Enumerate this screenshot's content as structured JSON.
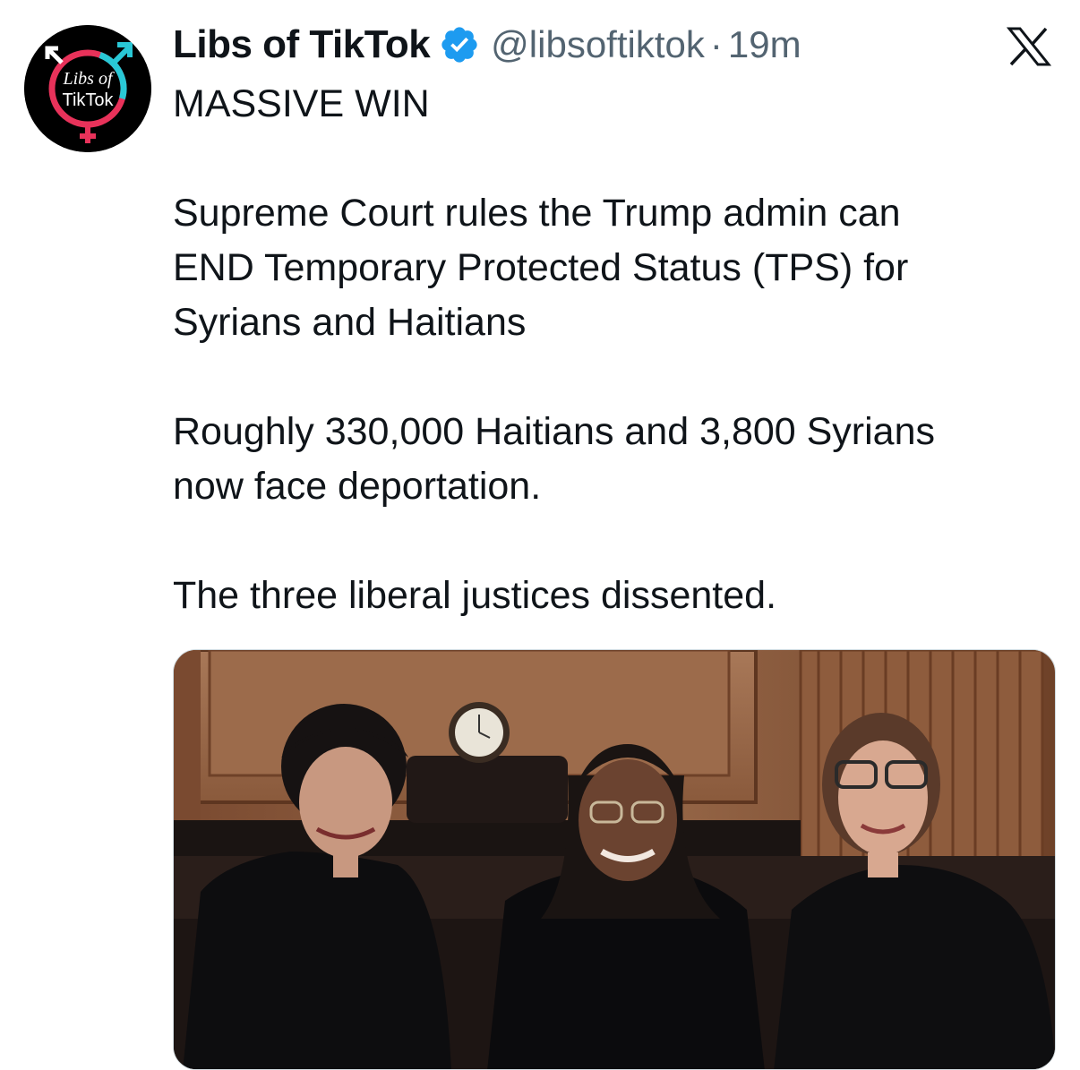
{
  "author": {
    "display_name": "Libs of TikTok",
    "handle": "@libsoftiktok",
    "separator": "·",
    "timestamp": "19m",
    "verified": true,
    "avatar_text": [
      "Libs of",
      "TikTok"
    ]
  },
  "platform": {
    "logo": "x-logo-icon"
  },
  "tweet": {
    "headline": "MASSIVE WIN",
    "paragraph_1_lines": [
      "Supreme Court rules the Trump admin can",
      "END Temporary Protected Status (TPS) for",
      "Syrians and Haitians"
    ],
    "paragraph_2_lines": [
      "Roughly 330,000 Haitians and 3,800 Syrians",
      "now face deportation."
    ],
    "paragraph_3": "The three liberal justices dissented."
  },
  "media": {
    "type": "photo",
    "subject": "three-people-in-black-robes-photo"
  },
  "colors": {
    "text": "#0f1419",
    "secondary": "#536471",
    "verified_blue": "#1d9bf0",
    "wood": "#8a5a3c"
  }
}
